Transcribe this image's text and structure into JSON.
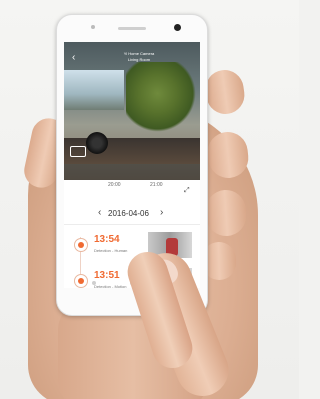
{
  "camera": {
    "title": "Yi Home Camera",
    "subtitle": "Living Room"
  },
  "timeline": {
    "labels": [
      "20:00",
      "21:00"
    ]
  },
  "date_nav": {
    "prev": "‹",
    "date": "2016-04-06",
    "next": "›"
  },
  "events": [
    {
      "time": "13:54",
      "type": "Detection - Human"
    },
    {
      "time": "13:51",
      "type": "Detection - Motion"
    }
  ],
  "colors": {
    "accent": "#f06a32"
  }
}
